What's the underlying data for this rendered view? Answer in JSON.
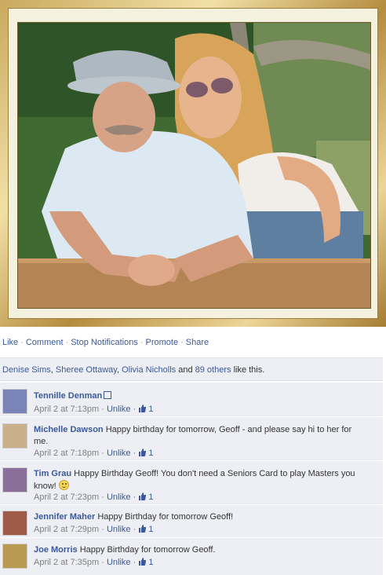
{
  "actions": {
    "like": "Like",
    "comment": "Comment",
    "stop_notifications": "Stop Notifications",
    "promote": "Promote",
    "share": "Share",
    "separator": "·"
  },
  "likes": {
    "names": [
      "Denise Sims",
      "Sheree Ottaway",
      "Olivia Nicholls"
    ],
    "others_link": "89 others",
    "and_text": "and",
    "suffix": "like this."
  },
  "comments": [
    {
      "author": "Tennille Denman",
      "text": "",
      "time": "April 2 at 7:13pm",
      "unlike": "Unlike",
      "like_count": "1",
      "avatar_color": "#7a84b8"
    },
    {
      "author": "Michelle Dawson",
      "text": "Happy birthday for tomorrow, Geoff - and please say hi to her for me.",
      "time": "April 2 at 7:18pm",
      "unlike": "Unlike",
      "like_count": "1",
      "avatar_color": "#c9b08a"
    },
    {
      "author": "Tim Grau",
      "text": "Happy Birthday Geoff! You don't need a Seniors Card to play Masters you know!",
      "time": "April 2 at 7:23pm",
      "unlike": "Unlike",
      "like_count": "1",
      "avatar_color": "#8a6f9b"
    },
    {
      "author": "Jennifer Maher",
      "text": "Happy Birthday for tomorrow Geoff!",
      "time": "April 2 at 7:29pm",
      "unlike": "Unlike",
      "like_count": "1",
      "avatar_color": "#a05a48"
    },
    {
      "author": "Joe Morris",
      "text": "Happy Birthday for tomorrow Geoff.",
      "time": "April 2 at 7:35pm",
      "unlike": "Unlike",
      "like_count": "1",
      "avatar_color": "#b89a52"
    }
  ],
  "colors": {
    "link": "#3b5998",
    "panel": "#edeff4",
    "frame_gold": "#c9a95e"
  }
}
